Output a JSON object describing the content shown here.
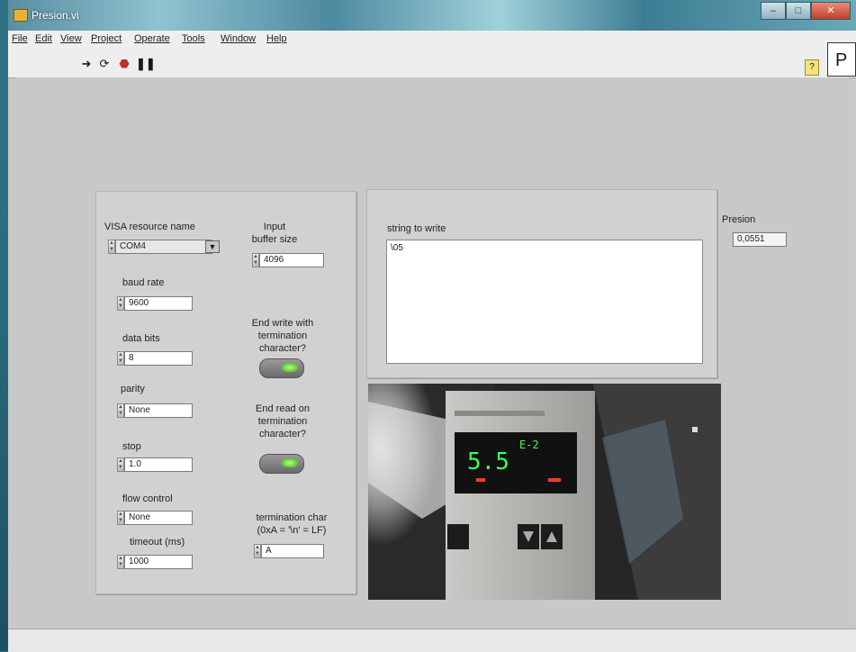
{
  "window": {
    "title": "Presion.vi"
  },
  "menu": [
    "File",
    "Edit",
    "View",
    "Project",
    "Operate",
    "Tools",
    "Window",
    "Help"
  ],
  "toolbar": {
    "run_icon": "run-arrow-icon",
    "run_cont_icon": "run-continuously-icon",
    "abort_icon": "abort-icon",
    "pause_icon": "pause-icon"
  },
  "corner_label": "P",
  "visa": {
    "label": "VISA resource name",
    "value": "COM4"
  },
  "input_buffer": {
    "label_line1": "Input",
    "label_line2": "buffer size",
    "value": "4096"
  },
  "baud": {
    "label": "baud rate",
    "value": "9600"
  },
  "data_bits": {
    "label": "data bits",
    "value": "8"
  },
  "parity": {
    "label": "parity",
    "value": "None"
  },
  "stop": {
    "label": "stop",
    "value": "1.0"
  },
  "flow": {
    "label": "flow control",
    "value": "None"
  },
  "timeout": {
    "label": "timeout (ms)",
    "value": "1000"
  },
  "end_write": {
    "line1": "End write with",
    "line2": "termination",
    "line3": "character?"
  },
  "end_read": {
    "line1": "End read on",
    "line2": "termination",
    "line3": "character?"
  },
  "term_char": {
    "line1": "termination char",
    "line2": "(0xA = '\\n' = LF)",
    "value": "A"
  },
  "string_to_write": {
    "label": "string to write",
    "value": "\\05"
  },
  "presion": {
    "label": "Presion",
    "value": "0,0551"
  },
  "camera": {
    "display_main": "5.5",
    "display_exp": "E-2"
  },
  "colors": {
    "led_green": "#3caa1e",
    "display_green": "#39ff5a"
  }
}
